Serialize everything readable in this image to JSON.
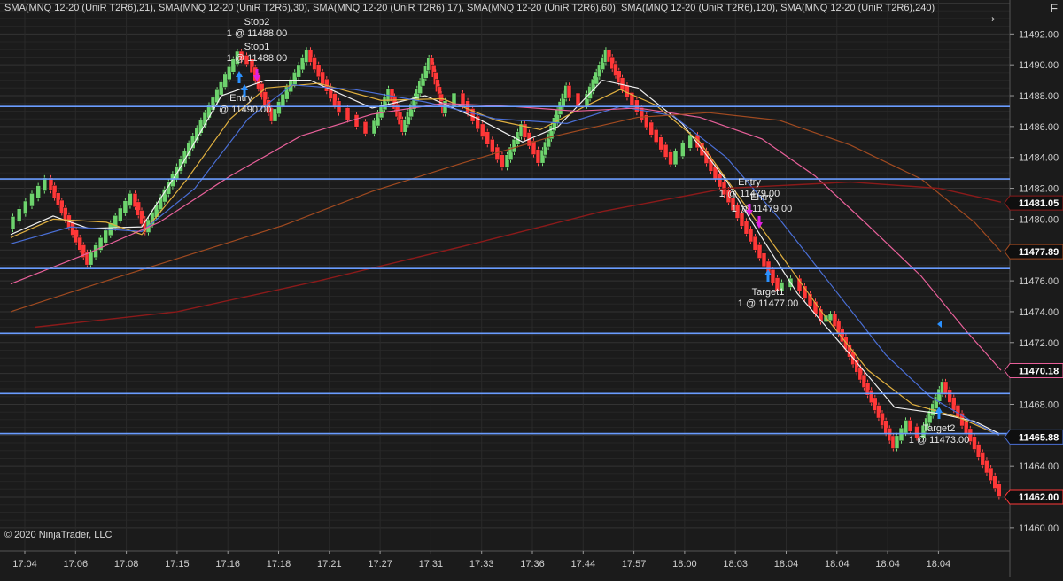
{
  "indicator_label": "SMA(MNQ 12-20 (UniR T2R6),21), SMA(MNQ 12-20 (UniR T2R6),30), SMA(MNQ 12-20 (UniR T2R6),17), SMA(MNQ 12-20 (UniR T2R6),60), SMA(MNQ 12-20 (UniR T2R6),120), SMA(MNQ 12-20 (UniR T2R6),240)",
  "top_right_letter": "F",
  "nav_arrow": "→",
  "copyright": "© 2020 NinjaTrader, LLC",
  "chart_data": {
    "type": "candlestick-renko",
    "y_ticks": [
      "11492.00",
      "11490.00",
      "11488.00",
      "11486.00",
      "11484.00",
      "11482.00",
      "11480.00",
      "11478.00",
      "11476.00",
      "11474.00",
      "11472.00",
      "11470.00",
      "11468.00",
      "11466.00",
      "11464.00",
      "11462.00",
      "11460.00"
    ],
    "ylim": [
      11458.5,
      11494.2
    ],
    "x_ticks": [
      "17:04",
      "17:06",
      "17:08",
      "17:15",
      "17:16",
      "17:18",
      "17:21",
      "17:27",
      "17:31",
      "17:33",
      "17:36",
      "17:44",
      "17:57",
      "18:00",
      "18:03",
      "18:04",
      "18:04",
      "18:04",
      "18:04"
    ],
    "price_tags": [
      "11481.05",
      "11477.89",
      "11470.18",
      "11465.88",
      "11462.00"
    ],
    "horizontal_lines": [
      11487.3,
      11482.6,
      11476.8,
      11472.6,
      11468.7,
      11466.1
    ],
    "trade_markers": [
      {
        "label": "Stop2",
        "detail": "1 @ 11488.00"
      },
      {
        "label": "Stop1",
        "detail": "1 @ 11488.00"
      },
      {
        "label": "Entry",
        "detail": "1 @ 11490.00"
      },
      {
        "label": "Entry",
        "detail": "1 @ 11479.00"
      },
      {
        "label": "Entry",
        "detail": "1 @ 11479.00"
      },
      {
        "label": "Target1",
        "detail": "1 @ 11477.00"
      },
      {
        "label": "Target2",
        "detail": "1 @ 11473.00"
      }
    ],
    "colors": {
      "up": "#6dd36d",
      "down": "#ff3838",
      "hline": "#6a9cff",
      "sma21": "#f0f0f0",
      "sma30": "#e0b040",
      "sma17": "#f5f5f5",
      "sma60": "#4a6fd6",
      "sma120": "#e8609a",
      "sma240": "#a04a20",
      "sma_long": "#8b1a1a"
    }
  }
}
